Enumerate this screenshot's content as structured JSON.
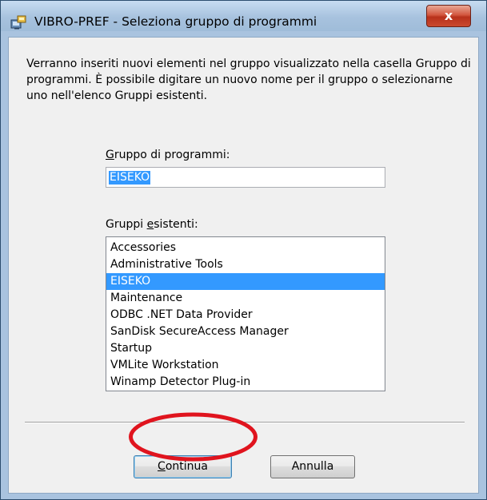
{
  "window": {
    "title": "VIBRO-PREF - Seleziona gruppo di programmi",
    "close_glyph": "x",
    "app_icon": "setup-icon"
  },
  "intro": {
    "text": "Verranno inseriti nuovi elementi nel gruppo visualizzato nella casella Gruppo di programmi. È possibile digitare un nuovo nome per il gruppo o selezionarne uno nell'elenco Gruppi esistenti."
  },
  "group_field": {
    "label_first": "G",
    "label_rest": "ruppo di programmi:",
    "value": "EISEKO"
  },
  "existing_groups": {
    "label_first": "Gruppi ",
    "label_u": "e",
    "label_rest": "sistenti:",
    "items": [
      "Accessories",
      "Administrative Tools",
      "EISEKO",
      "Maintenance",
      "ODBC .NET Data Provider",
      "SanDisk SecureAccess Manager",
      "Startup",
      "VMLite Workstation",
      "Winamp Detector Plug-in"
    ],
    "selected": "EISEKO"
  },
  "buttons": {
    "continue_u": "C",
    "continue_rest": "ontinua",
    "cancel_label": "Annulla"
  },
  "colors": {
    "selection": "#3399ff",
    "annotation": "#e0141e",
    "frame": "#a9c3df"
  }
}
